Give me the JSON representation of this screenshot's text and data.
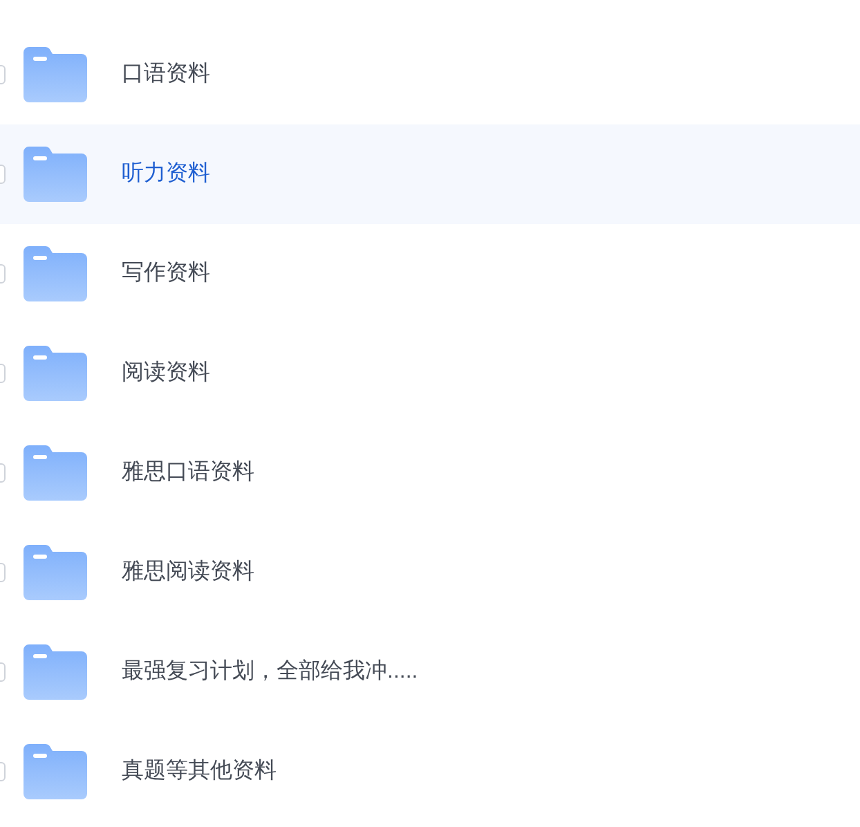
{
  "folders": [
    {
      "name": "口语资料",
      "selected": false
    },
    {
      "name": "听力资料",
      "selected": true
    },
    {
      "name": "写作资料",
      "selected": false
    },
    {
      "name": "阅读资料",
      "selected": false
    },
    {
      "name": "雅思口语资料",
      "selected": false
    },
    {
      "name": "雅思阅读资料",
      "selected": false
    },
    {
      "name": "最强复习计划，全部给我冲.....",
      "selected": false
    },
    {
      "name": "真题等其他资料",
      "selected": false
    }
  ]
}
